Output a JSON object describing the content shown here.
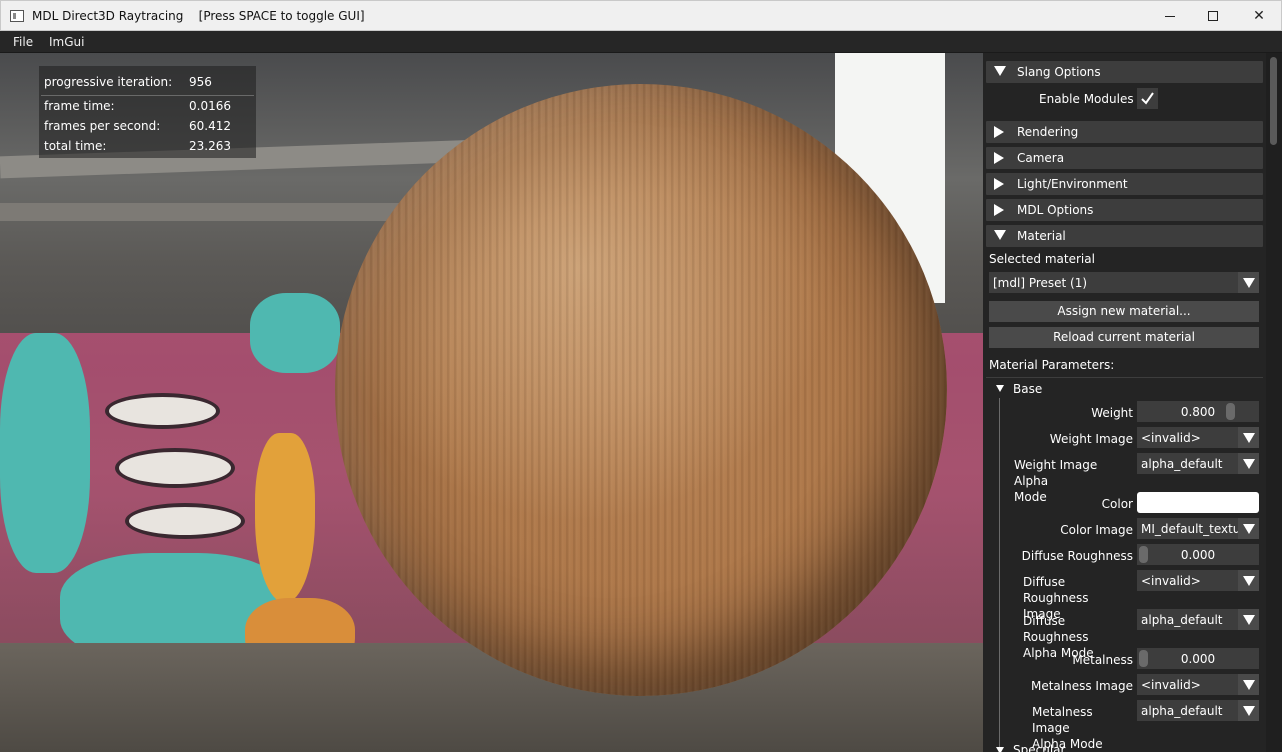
{
  "window": {
    "title": "MDL Direct3D Raytracing    [Press SPACE to toggle GUI]",
    "minimize_icon": "minimize-icon",
    "maximize_icon": "maximize-icon",
    "close_icon": "close-icon",
    "close_glyph": "✕"
  },
  "menu": {
    "items": [
      "File",
      "ImGui"
    ]
  },
  "stats": {
    "rows": [
      {
        "label": "progressive iteration:",
        "value": "956"
      },
      {
        "label": "frame time:",
        "value": "0.0166"
      },
      {
        "label": "frames per second:",
        "value": "60.412"
      },
      {
        "label": "total time:",
        "value": "23.263"
      }
    ]
  },
  "panel": {
    "headers": {
      "slang": "Slang Options",
      "rendering": "Rendering",
      "camera": "Camera",
      "light": "Light/Environment",
      "mdl": "MDL Options",
      "material": "Material"
    },
    "enable_modules_label": "Enable Modules",
    "enable_modules_checked": true,
    "selected_material_label": "Selected material",
    "selected_material_value": "[mdl] Preset (1)",
    "assign_button": "Assign new material...",
    "reload_button": "Reload current material",
    "material_parameters_label": "Material Parameters:",
    "base_node": "Base",
    "params": {
      "weight": {
        "label": "Weight",
        "value": "0.800",
        "fraction": 0.8
      },
      "weight_image": {
        "label": "Weight Image",
        "value": "<invalid>"
      },
      "weight_image_alpha_mode": {
        "label_line1": "Weight Image Alpha",
        "label_line2": "Mode",
        "value": "alpha_default"
      },
      "color": {
        "label": "Color",
        "value": "#ffffff"
      },
      "color_image": {
        "label": "Color Image",
        "value": "MI_default_textu"
      },
      "diffuse_roughness": {
        "label": "Diffuse Roughness",
        "value": "0.000",
        "fraction": 0
      },
      "diffuse_roughness_image": {
        "label_line1": "Diffuse Roughness",
        "label_line2": "Image",
        "value": "<invalid>"
      },
      "diffuse_roughness_alpha_mode": {
        "label_line1": "Diffuse Roughness",
        "label_line2": "Alpha Mode",
        "value": "alpha_default"
      },
      "metalness": {
        "label": "Metalness",
        "value": "0.000",
        "fraction": 0
      },
      "metalness_image": {
        "label": "Metalness Image",
        "value": "<invalid>"
      },
      "metalness_image_alpha_mode": {
        "label_line1": "Metalness Image",
        "label_line2": "Alpha Mode",
        "value": "alpha_default"
      }
    },
    "specular_node": "Specular"
  }
}
